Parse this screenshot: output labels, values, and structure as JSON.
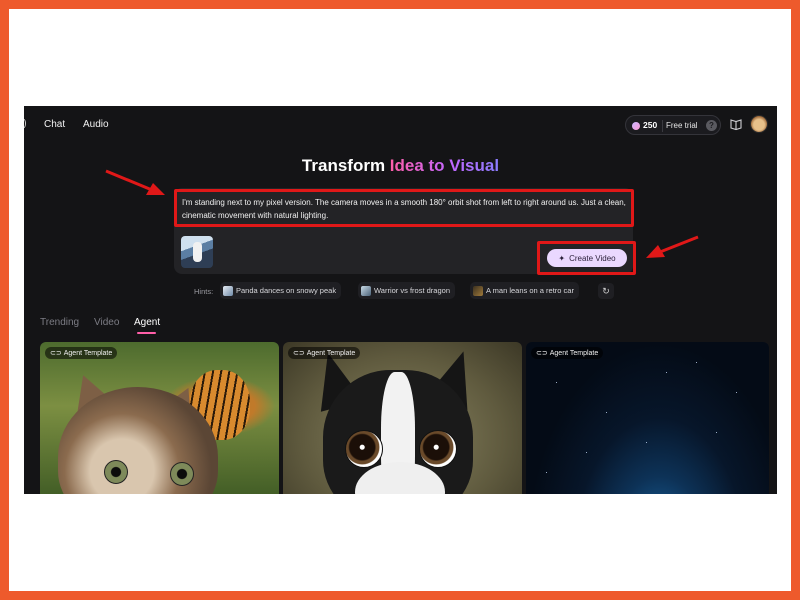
{
  "nav": {
    "items": [
      "Chat",
      "Audio"
    ],
    "credits": "250",
    "free_trial": "Free trial",
    "help_glyph": "?"
  },
  "hero": {
    "title_prefix": "Transform ",
    "title_highlight": "Idea to Visual"
  },
  "prompt": {
    "text": "I'm standing next to my pixel version. The camera moves in a smooth 180° orbit shot from left to right around us. Just a clean, cinematic movement with natural lighting.",
    "button_label": "Create Video"
  },
  "hints": {
    "label": "Hints:",
    "items": [
      "Panda dances on snowy peak",
      "Warrior vs frost dragon",
      "A man leans on a retro car"
    ]
  },
  "tabs": {
    "items": [
      "Trending",
      "Video",
      "Agent"
    ],
    "active": "Agent"
  },
  "cards": [
    {
      "badge": "Agent Template",
      "subject": "cat-and-tiger"
    },
    {
      "badge": "Agent Template",
      "subject": "boston-terrier"
    },
    {
      "badge": "Agent Template",
      "subject": "starry-sky"
    }
  ],
  "colors": {
    "outer_border": "#ee5a2c",
    "background": "#141416",
    "annotation_red": "#e01818",
    "button_bg": "#ead8ff",
    "accent_pink": "#ff5fa8"
  },
  "icons": [
    "diamond-icon",
    "help-icon",
    "book-icon",
    "sparkle-icon",
    "link-icon",
    "refresh-icon"
  ]
}
